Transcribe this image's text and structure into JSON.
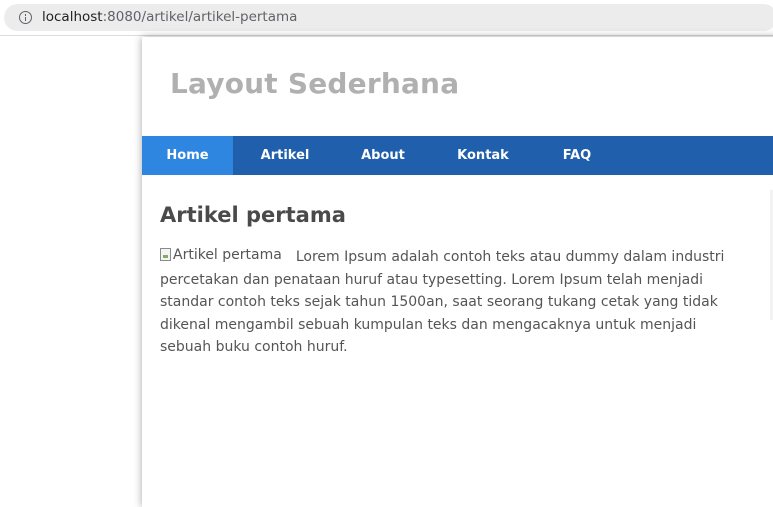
{
  "browser": {
    "url_host": "localhost",
    "url_path": ":8080/artikel/artikel-pertama",
    "info_icon": "info-icon"
  },
  "site": {
    "title": "Layout Sederhana"
  },
  "nav": {
    "items": [
      {
        "label": "Home",
        "active": true
      },
      {
        "label": "Artikel",
        "active": false
      },
      {
        "label": "About",
        "active": false
      },
      {
        "label": "Kontak",
        "active": false
      },
      {
        "label": "FAQ",
        "active": false
      }
    ]
  },
  "article": {
    "title": "Artikel pertama",
    "image_alt": "Artikel pertama",
    "body": "Lorem Ipsum adalah contoh teks atau dummy dalam industri percetakan dan penataan huruf atau typesetting. Lorem Ipsum telah menjadi standar contoh teks sejak tahun 1500an, saat seorang tukang cetak yang tidak dikenal mengambil sebuah kumpulan teks dan mengacaknya untuk menjadi sebuah buku contoh huruf."
  },
  "colors": {
    "nav_background": "#1f5fab",
    "nav_active": "#2f86e0",
    "title_text": "#b0b0b0",
    "body_text": "#555555"
  }
}
